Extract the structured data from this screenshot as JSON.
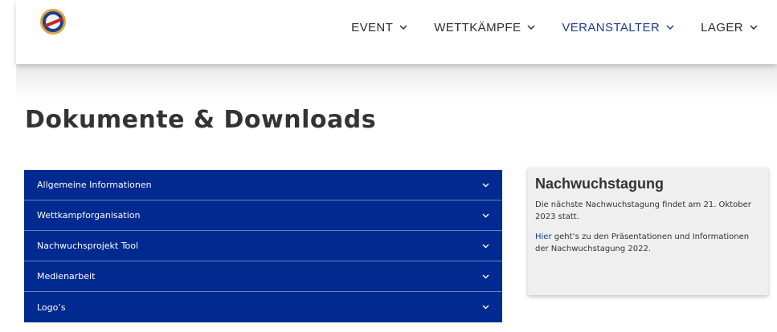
{
  "header": {
    "nav": [
      {
        "label": "EVENT",
        "active": false
      },
      {
        "label": "WETTKÄMPFE",
        "active": false
      },
      {
        "label": "VERANSTALTER",
        "active": true
      },
      {
        "label": "LAGER",
        "active": false
      }
    ],
    "logo_icon": "club-logo"
  },
  "page": {
    "title": "Dokumente & Downloads"
  },
  "accordion": {
    "items": [
      {
        "label": "Allgemeine Informationen"
      },
      {
        "label": "Wettkampforganisation"
      },
      {
        "label": "Nachwuchsprojekt Tool"
      },
      {
        "label": "Medienarbeit"
      },
      {
        "label": "Logo’s"
      }
    ],
    "icon": "chevron-down-icon"
  },
  "sidebar": {
    "title": "Nachwuchstagung",
    "text1": "Die nächste Nachwuchstagung findet am 21. Oktober 2023 statt.",
    "link_text": "Hier",
    "text2_rest": " geht’s zu den Präsentationen und Informationen der Nachwuchstagung 2022."
  },
  "colors": {
    "accent": "#002a8f",
    "nav_active": "#1b3c90",
    "sidebar_bg": "#efefef"
  }
}
